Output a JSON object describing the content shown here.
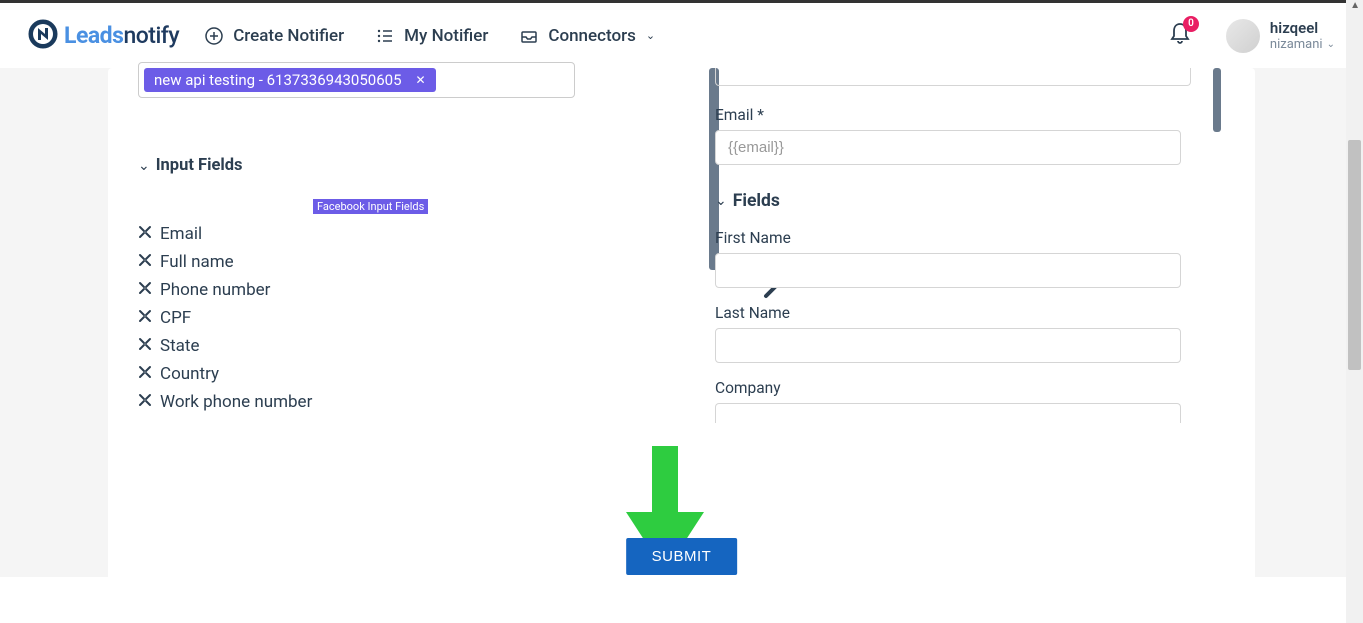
{
  "header": {
    "logo": {
      "bold": "Leads",
      "rest": "notify"
    },
    "nav": {
      "create": "Create Notifier",
      "my": "My Notifier",
      "connectors": "Connectors"
    },
    "notifications_count": "0",
    "user": {
      "name": "hizqeel",
      "role": "nizamani"
    }
  },
  "left": {
    "tag": "new api testing - 6137336943050605",
    "section_title": "Input Fields",
    "badge": "Facebook Input Fields",
    "fields": [
      "Email",
      "Full name",
      "Phone number",
      "CPF",
      "State",
      "Country",
      "Work phone number"
    ]
  },
  "right": {
    "email_label": "Email *",
    "email_placeholder": "{{email}}",
    "fields_title": "Fields",
    "fields": [
      {
        "label": "First Name"
      },
      {
        "label": "Last Name"
      },
      {
        "label": "Company"
      }
    ]
  },
  "submit": "SUBMIT"
}
